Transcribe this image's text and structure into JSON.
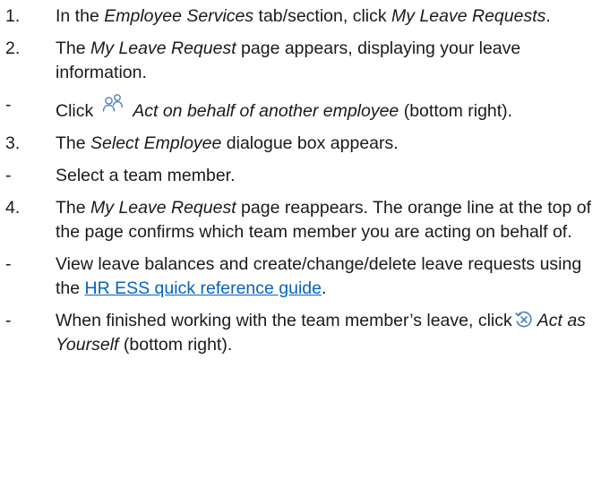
{
  "steps": [
    {
      "marker": "1.",
      "parts": [
        {
          "t": "In the "
        },
        {
          "t": "Employee Services",
          "i": true
        },
        {
          "t": " tab/section, click "
        },
        {
          "t": "My Leave Requests",
          "i": true
        },
        {
          "t": "."
        }
      ]
    },
    {
      "marker": "2.",
      "parts": [
        {
          "t": "The "
        },
        {
          "t": "My Leave Request",
          "i": true
        },
        {
          "t": " page appears, displaying your leave information."
        }
      ]
    },
    {
      "marker": "-",
      "parts": [
        {
          "t": "Click"
        },
        {
          "icon": "people-icon"
        },
        {
          "t": "Act on behalf of another employee",
          "i": true
        },
        {
          "t": " (bottom right)."
        }
      ]
    },
    {
      "marker": "3.",
      "parts": [
        {
          "t": "The "
        },
        {
          "t": "Select Employee",
          "i": true
        },
        {
          "t": " dialogue box appears."
        }
      ]
    },
    {
      "marker": "-",
      "parts": [
        {
          "t": "Select a team member."
        }
      ]
    },
    {
      "marker": "4.",
      "parts": [
        {
          "t": "The "
        },
        {
          "t": "My Leave Request",
          "i": true
        },
        {
          "t": " page reappears. The orange line at the top of the page confirms which team member you are acting on behalf of."
        }
      ]
    },
    {
      "marker": "-",
      "parts": [
        {
          "t": "View leave balances and create/change/delete leave requests using the "
        },
        {
          "t": "HR ESS quick reference guide",
          "link": true
        },
        {
          "t": "."
        }
      ]
    },
    {
      "marker": "-",
      "parts": [
        {
          "t": "When finished working with the team member’s leave, click"
        },
        {
          "icon": "act-as-yourself-icon"
        },
        {
          "t": "Act as Yourself",
          "i": true
        },
        {
          "t": " (bottom right)."
        }
      ]
    }
  ],
  "colors": {
    "text": "#1a1a1a",
    "link": "#0563c1",
    "icon_blue": "#4a7fc1"
  }
}
